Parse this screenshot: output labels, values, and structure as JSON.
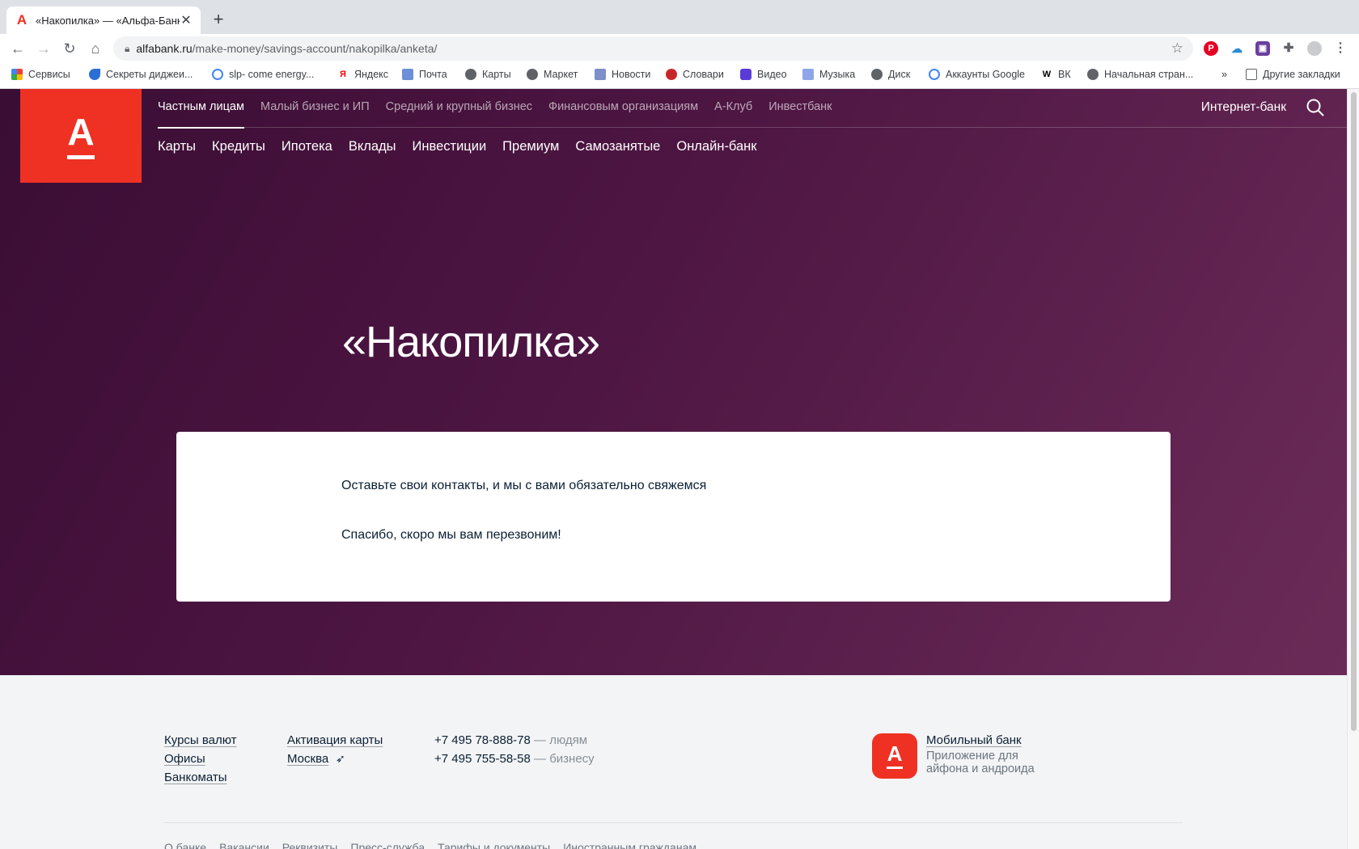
{
  "browser": {
    "tab_title": "«Накопилка» — «Альфа-Банк»",
    "tab_favicon": "alfa-icon",
    "new_tab": "+",
    "url_domain": "alfabank.ru",
    "url_path": "/make-money/savings-account/nakopilka/anketa/"
  },
  "bookmarks": [
    {
      "label": "Сервисы",
      "icon": "apps-icon"
    },
    {
      "label": "Секреты диджеи...",
      "icon": "drop-icon"
    },
    {
      "label": "slp- come energy...",
      "icon": "google-icon"
    },
    {
      "label": "Яндекс",
      "icon": "yandex-icon"
    },
    {
      "label": "Почта",
      "icon": "mail-icon"
    },
    {
      "label": "Карты",
      "icon": "globe-icon"
    },
    {
      "label": "Маркет",
      "icon": "globe-icon"
    },
    {
      "label": "Новости",
      "icon": "news-icon"
    },
    {
      "label": "Словари",
      "icon": "dict-icon"
    },
    {
      "label": "Видео",
      "icon": "video-icon"
    },
    {
      "label": "Музыка",
      "icon": "music-icon"
    },
    {
      "label": "Диск",
      "icon": "globe-icon"
    },
    {
      "label": "Аккаунты Google",
      "icon": "google-icon"
    },
    {
      "label": "ВК",
      "icon": "w-icon"
    },
    {
      "label": "Начальная стран...",
      "icon": "globe-icon"
    }
  ],
  "bookmarks_more": "»",
  "other_bookmarks": "Другие закладки",
  "site": {
    "logo_letter": "А",
    "top_nav": [
      "Частным лицам",
      "Малый бизнес и ИП",
      "Средний и крупный бизнес",
      "Финансовым организациям",
      "А-Клуб",
      "Инвестбанк"
    ],
    "internet_bank": "Интернет-банк",
    "sub_nav": [
      "Карты",
      "Кредиты",
      "Ипотека",
      "Вклады",
      "Инвестиции",
      "Премиум",
      "Самозанятые",
      "Онлайн-банк"
    ],
    "hero_title": "«Накопилка»",
    "card_text_1": "Оставьте свои контакты, и мы с вами обязательно свяжемся",
    "card_text_2": "Спасибо, скоро мы вам перезвоним!"
  },
  "footer": {
    "col1": [
      "Курсы валют",
      "Офисы",
      "Банкоматы"
    ],
    "activation": "Активация карты",
    "city": "Москва",
    "phone1": "+7 495 78-888-78",
    "phone1_note": " — людям",
    "phone2": "+7 495 755-58-58",
    "phone2_note": " — бизнесу",
    "app_title": "Мобильный банк",
    "app_desc_1": "Приложение для",
    "app_desc_2": "айфона и андроида",
    "bottom_links": [
      "О банке",
      "Вакансии",
      "Реквизиты",
      "Пресс-служба",
      "Тарифы и документы",
      "Иностранным гражданам"
    ]
  },
  "colors": {
    "brand_red": "#ef3124",
    "hero_dark": "#3a0d34",
    "hero_light": "#6b2b58"
  }
}
